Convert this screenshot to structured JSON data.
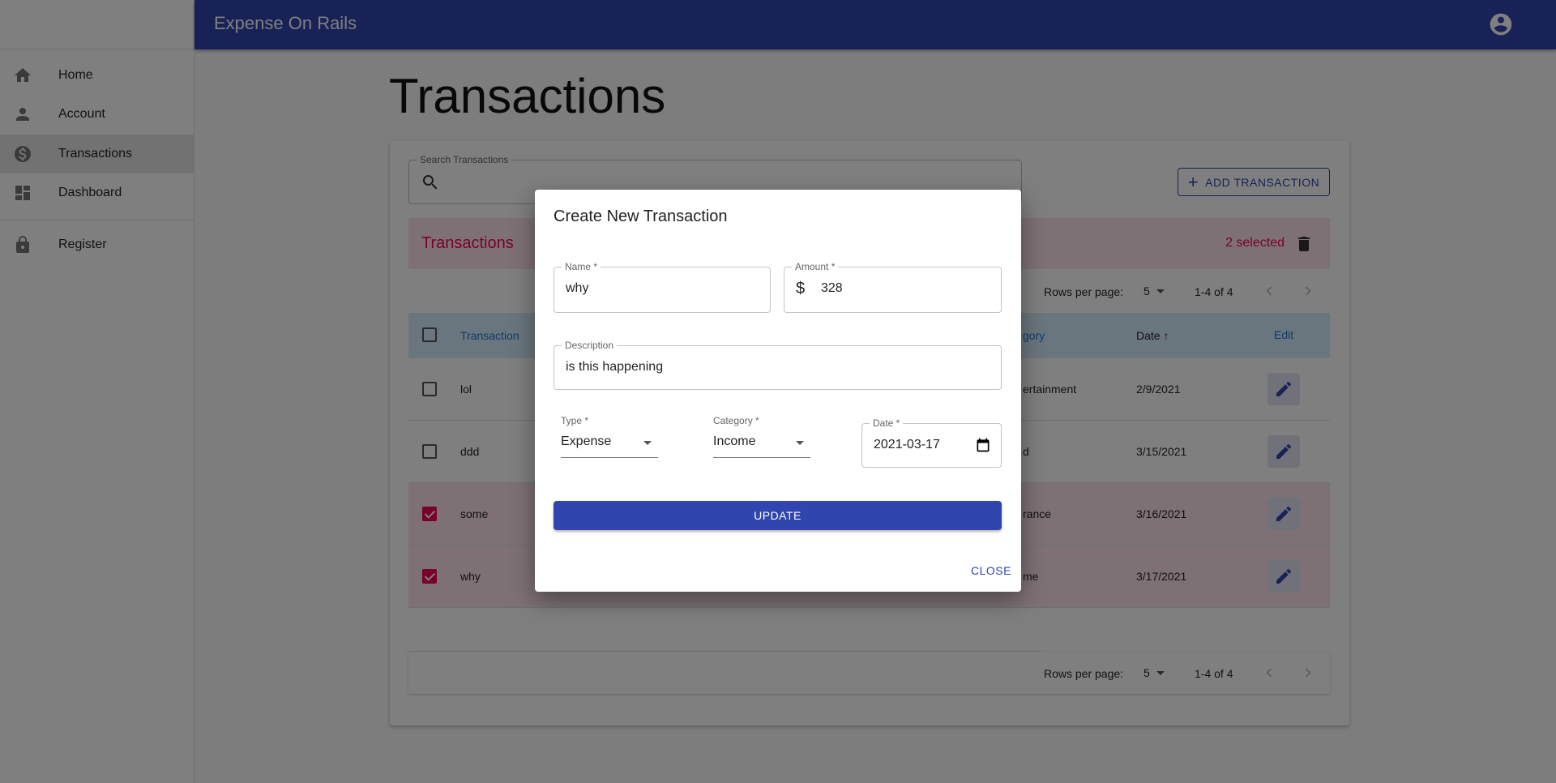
{
  "app": {
    "title": "Expense On Rails",
    "account_icon": "account-circle-icon"
  },
  "sidebar": {
    "items": [
      {
        "label": "Home",
        "icon": "home-icon"
      },
      {
        "label": "Account",
        "icon": "person-icon"
      },
      {
        "label": "Transactions",
        "icon": "dollar-icon",
        "selected": true
      },
      {
        "label": "Dashboard",
        "icon": "dashboard-icon"
      },
      {
        "label": "Register",
        "icon": "lock-icon"
      }
    ]
  },
  "page": {
    "title": "Transactions"
  },
  "search": {
    "label": "Search Transactions",
    "value": ""
  },
  "add_button": "ADD TRANSACTION",
  "table": {
    "title": "Transactions",
    "selected_text": "2 selected",
    "pagination": {
      "rows_label": "Rows per page:",
      "rows": "5",
      "range": "1-4 of 4"
    },
    "headers": {
      "transaction": "Transaction",
      "category": "gory",
      "date": "Date",
      "edit": "Edit"
    },
    "rows": [
      {
        "name": "lol",
        "category": "ertainment",
        "date": "2/9/2021",
        "checked": false
      },
      {
        "name": "ddd",
        "category": "d",
        "date": "3/15/2021",
        "checked": false
      },
      {
        "name": "some",
        "category": "rance",
        "date": "3/16/2021",
        "checked": true
      },
      {
        "name": "why",
        "category": "me",
        "date": "3/17/2021",
        "checked": true
      }
    ]
  },
  "dialog": {
    "title": "Create New Transaction",
    "name": {
      "label": "Name *",
      "value": "why"
    },
    "amount": {
      "label": "Amount *",
      "prefix": "$",
      "value": "328"
    },
    "description": {
      "label": "Description",
      "value": "is this happening"
    },
    "type": {
      "label": "Type *",
      "value": "Expense"
    },
    "category": {
      "label": "Category *",
      "value": "Income"
    },
    "date": {
      "label": "Date *",
      "value": "2021-03-17"
    },
    "update": "UPDATE",
    "close": "CLOSE"
  },
  "colors": {
    "primary": "#3045ae",
    "secondary": "#f50057",
    "header_bg": "#d5ecfb"
  }
}
